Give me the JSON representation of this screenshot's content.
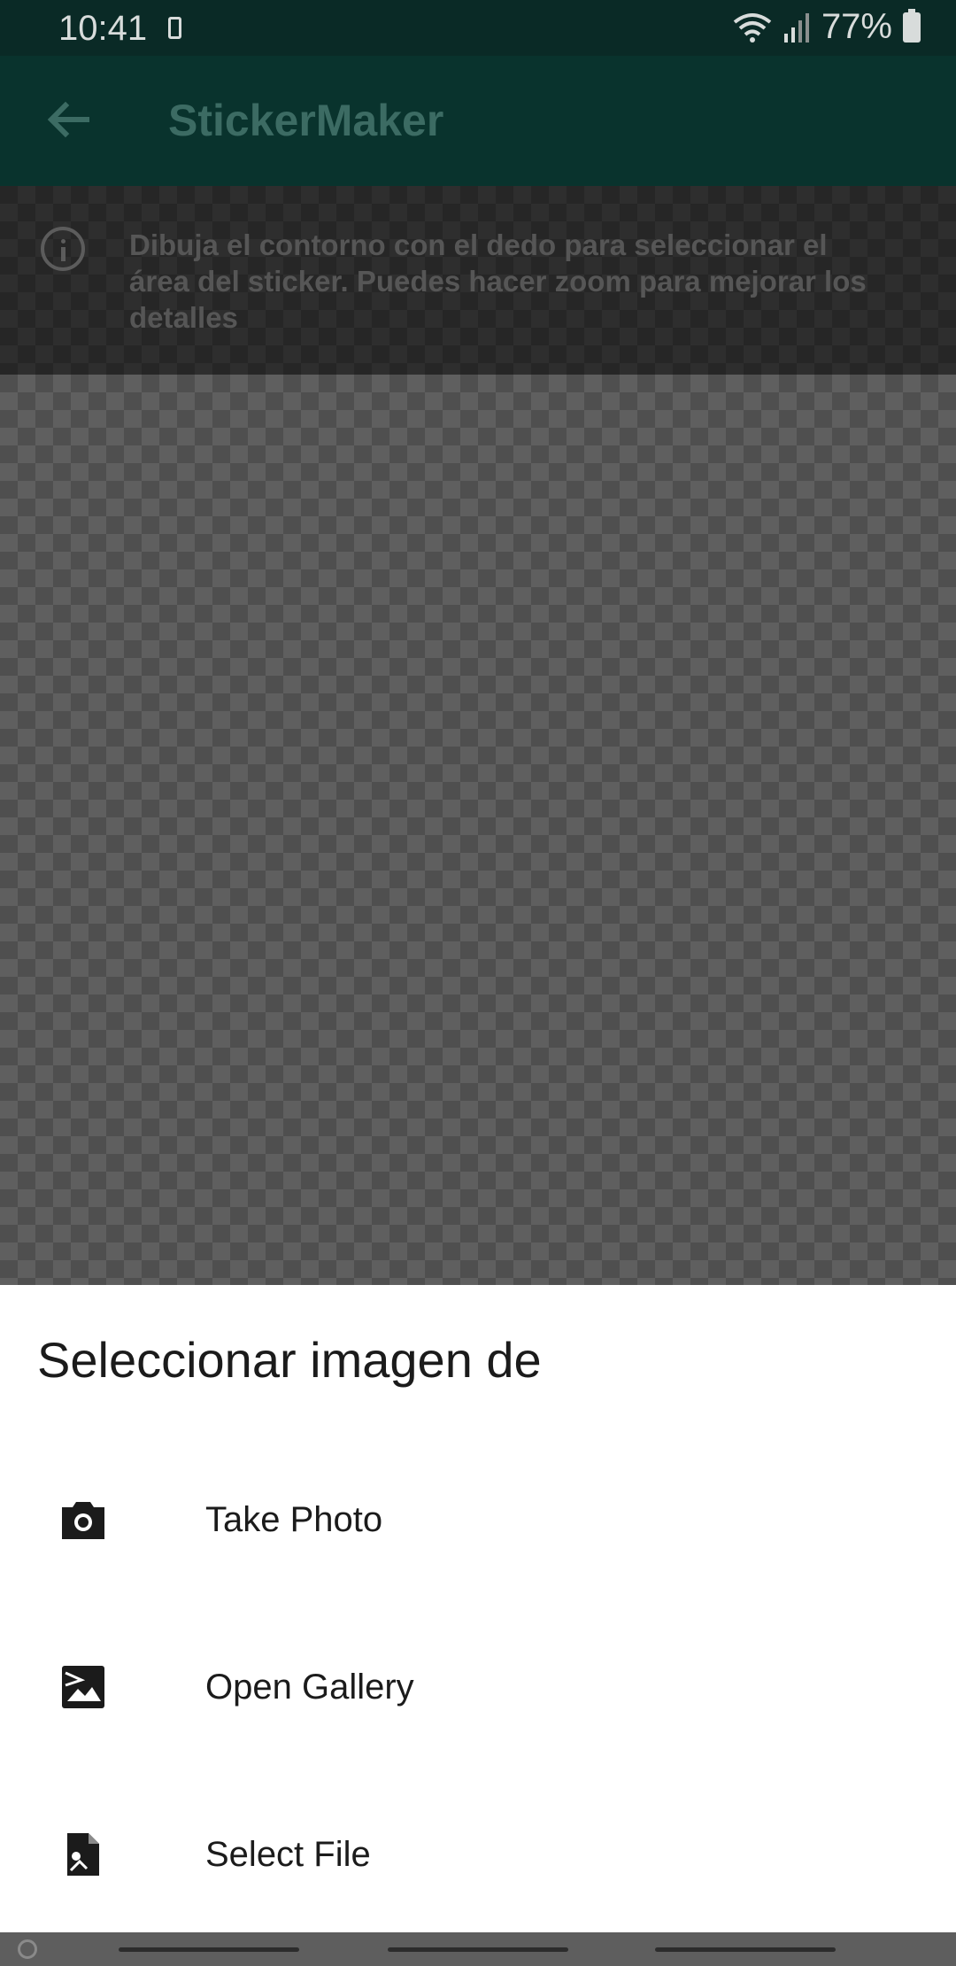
{
  "status_bar": {
    "time": "10:41",
    "battery": "77%"
  },
  "app_bar": {
    "title": "StickerMaker"
  },
  "info_banner": {
    "text": "Dibuja el contorno con el dedo para seleccionar el área del sticker. Puedes hacer zoom para mejorar los detalles"
  },
  "sheet": {
    "title": "Seleccionar imagen de",
    "items": [
      {
        "label": "Take Photo",
        "icon": "camera-icon"
      },
      {
        "label": "Open Gallery",
        "icon": "gallery-icon"
      },
      {
        "label": "Select File",
        "icon": "file-icon"
      }
    ]
  },
  "colors": {
    "status_bar": "#0a2a26",
    "app_bar": "#09332d",
    "sheet_background": "#ffffff"
  }
}
